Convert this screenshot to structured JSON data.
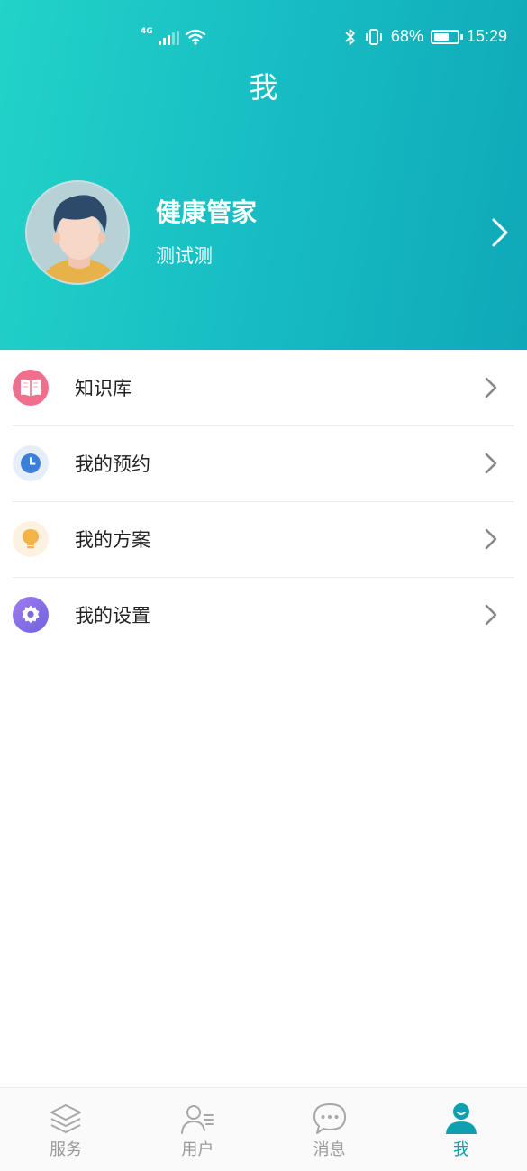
{
  "status_bar": {
    "network": "4G",
    "battery_text": "68%",
    "battery_level": 0.68,
    "time": "15:29"
  },
  "header": {
    "title": "我"
  },
  "profile": {
    "name": "健康管家",
    "subtitle": "测试测"
  },
  "menu": {
    "items": [
      {
        "label": "知识库",
        "icon": "book-icon",
        "color": "#ef6b8a"
      },
      {
        "label": "我的预约",
        "icon": "clock-icon",
        "color": "#3d7fd8"
      },
      {
        "label": "我的方案",
        "icon": "lightbulb-icon",
        "color": "#f3b44a"
      },
      {
        "label": "我的设置",
        "icon": "gear-icon",
        "color": "#8a6fe6"
      }
    ]
  },
  "tabbar": {
    "items": [
      {
        "label": "服务",
        "icon": "layers-icon",
        "active": false
      },
      {
        "label": "用户",
        "icon": "user-list-icon",
        "active": false
      },
      {
        "label": "消息",
        "icon": "chat-bubble-icon",
        "active": false
      },
      {
        "label": "我",
        "icon": "person-icon",
        "active": true
      }
    ],
    "active_color": "#0f9fb0",
    "inactive_color": "#9a9a9a"
  }
}
